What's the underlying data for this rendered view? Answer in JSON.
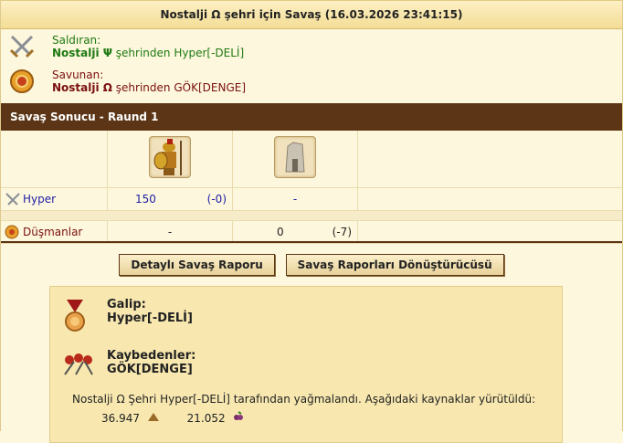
{
  "header": {
    "title": "Nostalji Ω şehri için Savaş (16.03.2026 23:41:15)"
  },
  "attacker": {
    "role": "Saldıran:",
    "city": "Nostalji Ψ",
    "mid": " şehrinden ",
    "player": "Hyper[-DELİ]"
  },
  "defender": {
    "role": "Savunan:",
    "city": "Nostalji Ω",
    "mid": " şehrinden ",
    "player": "GÖK[DENGE]"
  },
  "result": {
    "title": "Savaş Sonucu - Raund 1"
  },
  "rows": [
    {
      "name": "Hyper",
      "u1": "150",
      "u1_loss": "(-0)",
      "u2": "-",
      "u2_loss": ""
    },
    {
      "name": "Düşmanlar",
      "u1": "-",
      "u1_loss": "",
      "u2": "0",
      "u2_loss": "(-7)"
    }
  ],
  "buttons": {
    "detail": "Detaylı Savaş Raporu",
    "converter": "Savaş Raporları Dönüştürücüsü"
  },
  "summary": {
    "winner_label": "Galip:",
    "winner": "Hyper[-DELİ]",
    "losers_label": "Kaybedenler:",
    "losers": "GÖK[DENGE]",
    "loot_text": "Nostalji Ω Şehri Hyper[-DELİ] tarafından yağmalandı. Aşağıdaki kaynaklar yürütüldü:",
    "loot": [
      {
        "amount": "36.947",
        "icon": "wood-icon"
      },
      {
        "amount": "21.052",
        "icon": "wine-icon"
      }
    ]
  },
  "colors": {
    "bar": "#5b3515",
    "attacker": "#1e7a12",
    "defender": "#7a1010",
    "link": "#2020a8"
  }
}
